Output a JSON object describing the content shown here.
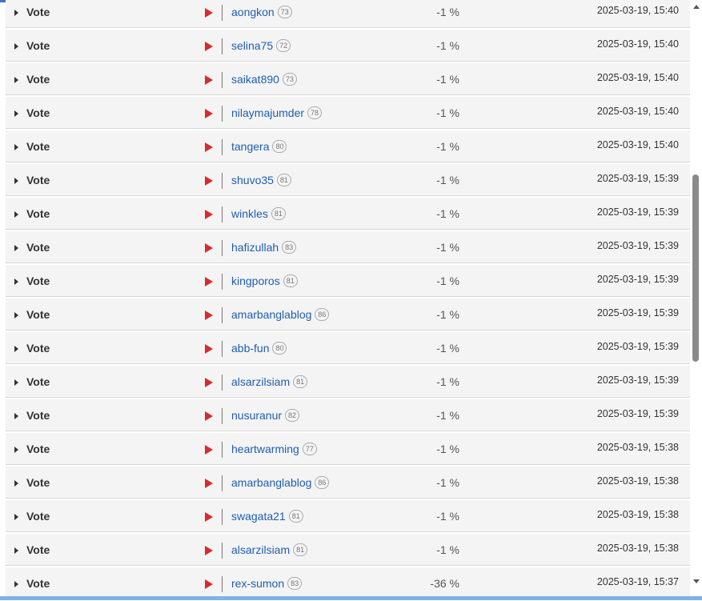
{
  "rows": [
    {
      "type": "Vote",
      "user": "aongkon",
      "rep": "73",
      "percent": "-1 %",
      "time": "2025-03-19, 15:40"
    },
    {
      "type": "Vote",
      "user": "selina75",
      "rep": "72",
      "percent": "-1 %",
      "time": "2025-03-19, 15:40"
    },
    {
      "type": "Vote",
      "user": "saikat890",
      "rep": "73",
      "percent": "-1 %",
      "time": "2025-03-19, 15:40"
    },
    {
      "type": "Vote",
      "user": "nilaymajumder",
      "rep": "78",
      "percent": "-1 %",
      "time": "2025-03-19, 15:40"
    },
    {
      "type": "Vote",
      "user": "tangera",
      "rep": "80",
      "percent": "-1 %",
      "time": "2025-03-19, 15:40"
    },
    {
      "type": "Vote",
      "user": "shuvo35",
      "rep": "81",
      "percent": "-1 %",
      "time": "2025-03-19, 15:39"
    },
    {
      "type": "Vote",
      "user": "winkles",
      "rep": "81",
      "percent": "-1 %",
      "time": "2025-03-19, 15:39"
    },
    {
      "type": "Vote",
      "user": "hafizullah",
      "rep": "83",
      "percent": "-1 %",
      "time": "2025-03-19, 15:39"
    },
    {
      "type": "Vote",
      "user": "kingporos",
      "rep": "81",
      "percent": "-1 %",
      "time": "2025-03-19, 15:39"
    },
    {
      "type": "Vote",
      "user": "amarbanglablog",
      "rep": "86",
      "percent": "-1 %",
      "time": "2025-03-19, 15:39"
    },
    {
      "type": "Vote",
      "user": "abb-fun",
      "rep": "80",
      "percent": "-1 %",
      "time": "2025-03-19, 15:39"
    },
    {
      "type": "Vote",
      "user": "alsarzilsiam",
      "rep": "81",
      "percent": "-1 %",
      "time": "2025-03-19, 15:39"
    },
    {
      "type": "Vote",
      "user": "nusuranur",
      "rep": "82",
      "percent": "-1 %",
      "time": "2025-03-19, 15:39"
    },
    {
      "type": "Vote",
      "user": "heartwarming",
      "rep": "77",
      "percent": "-1 %",
      "time": "2025-03-19, 15:38"
    },
    {
      "type": "Vote",
      "user": "amarbanglablog",
      "rep": "86",
      "percent": "-1 %",
      "time": "2025-03-19, 15:38"
    },
    {
      "type": "Vote",
      "user": "swagata21",
      "rep": "81",
      "percent": "-1 %",
      "time": "2025-03-19, 15:38"
    },
    {
      "type": "Vote",
      "user": "alsarzilsiam",
      "rep": "81",
      "percent": "-1 %",
      "time": "2025-03-19, 15:38"
    },
    {
      "type": "Vote",
      "user": "rex-sumon",
      "rep": "83",
      "percent": "-36 %",
      "time": "2025-03-19, 15:37"
    }
  ],
  "icons": {
    "expand": "caret-right-icon",
    "vote_flag": "red-arrow-icon"
  },
  "colors": {
    "accent": "#3f72c9",
    "link": "#1f5db3",
    "flag": "#d92b2b"
  }
}
